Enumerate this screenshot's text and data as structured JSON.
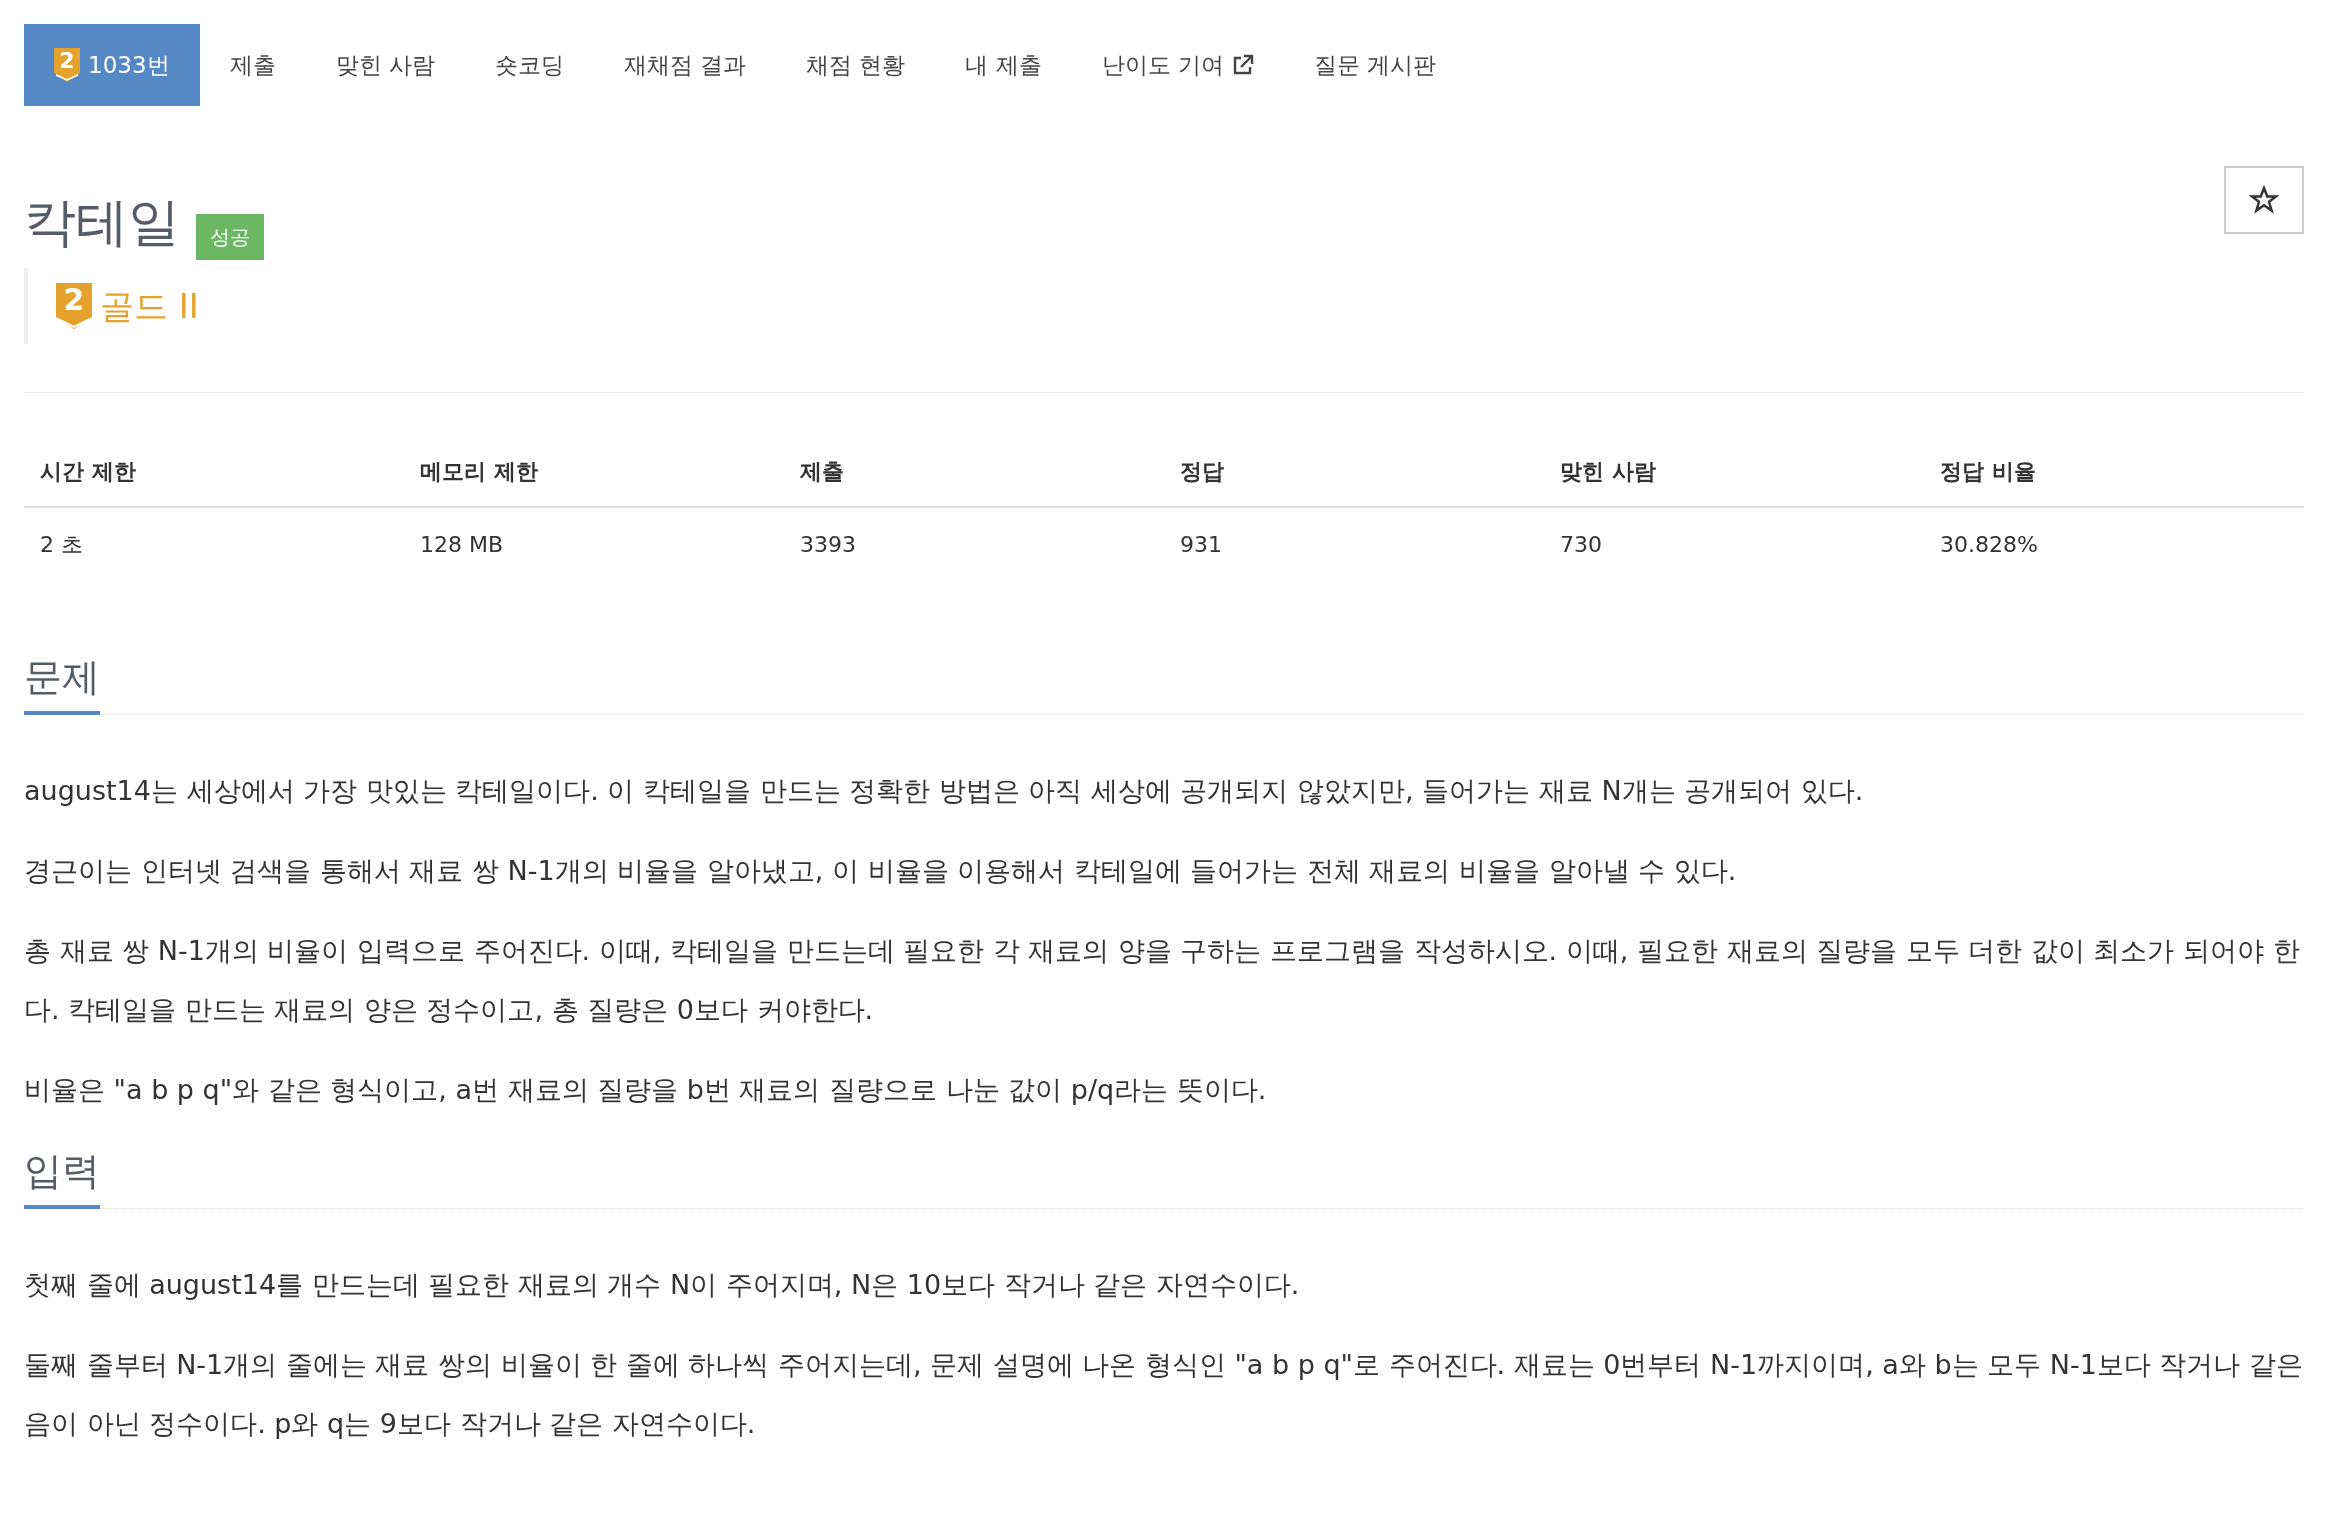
{
  "tabs": [
    {
      "label": "1033번",
      "tier": "2",
      "selected": true,
      "external": false
    },
    {
      "label": "제출",
      "selected": false,
      "external": false
    },
    {
      "label": "맞힌 사람",
      "selected": false,
      "external": false
    },
    {
      "label": "숏코딩",
      "selected": false,
      "external": false
    },
    {
      "label": "재채점 결과",
      "selected": false,
      "external": false
    },
    {
      "label": "채점 현황",
      "selected": false,
      "external": false
    },
    {
      "label": "내 제출",
      "selected": false,
      "external": false
    },
    {
      "label": "난이도 기여",
      "selected": false,
      "external": true
    },
    {
      "label": "질문 게시판",
      "selected": false,
      "external": false
    }
  ],
  "problem": {
    "title": "칵테일",
    "status_label": "성공",
    "tier_number": "2",
    "tier_label": "골드 II"
  },
  "info_table": {
    "columns": [
      "시간 제한",
      "메모리 제한",
      "제출",
      "정답",
      "맞힌 사람",
      "정답 비율"
    ],
    "rows": [
      [
        "2 초",
        "128 MB",
        "3393",
        "931",
        "730",
        "30.828%"
      ]
    ]
  },
  "sections": [
    {
      "heading": "문제",
      "paragraphs": [
        "august14는 세상에서 가장 맛있는 칵테일이다. 이 칵테일을 만드는 정확한 방법은 아직 세상에 공개되지 않았지만, 들어가는 재료 N개는 공개되어 있다.",
        "경근이는 인터넷 검색을 통해서 재료 쌍 N-1개의 비율을 알아냈고, 이 비율을 이용해서 칵테일에 들어가는 전체 재료의 비율을 알아낼 수 있다.",
        "총 재료 쌍 N-1개의 비율이 입력으로 주어진다. 이때, 칵테일을 만드는데 필요한 각 재료의 양을 구하는 프로그램을 작성하시오. 이때, 필요한 재료의 질량을 모두 더한 값이 최소가 되어야 한다. 칵테일을 만드는 재료의 양은 정수이고, 총 질량은 0보다 커야한다.",
        "비율은 \"a b p q\"와 같은 형식이고, a번 재료의 질량을 b번 재료의 질량으로 나눈 값이 p/q라는 뜻이다."
      ]
    },
    {
      "heading": "입력",
      "paragraphs": [
        "첫째 줄에 august14를 만드는데 필요한 재료의 개수 N이 주어지며, N은 10보다 작거나 같은 자연수이다.",
        "둘째 줄부터 N-1개의 줄에는 재료 쌍의 비율이 한 줄에 하나씩 주어지는데, 문제 설명에 나온 형식인 \"a b p q\"로 주어진다. 재료는 0번부터 N-1까지이며, a와 b는 모두 N-1보다 작거나 같은 음이 아닌 정수이다. p와 q는 9보다 작거나 같은 자연수이다."
      ]
    }
  ]
}
